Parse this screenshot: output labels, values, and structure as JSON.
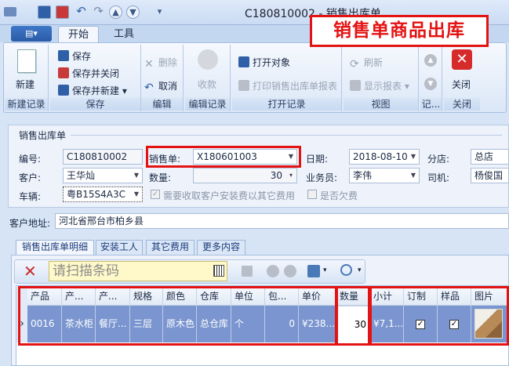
{
  "window": {
    "title": "C180810002 - 销售出库单"
  },
  "quick_access": {
    "separator": "|"
  },
  "callout": "销售单商品出库",
  "file_menu_glyph": "▤▾",
  "tabs": {
    "home": "开始",
    "tools": "工具"
  },
  "ribbon": {
    "new": "新建",
    "save": "保存",
    "save_close": "保存并关闭",
    "save_new": "保存并新建",
    "delete": "删除",
    "undo": "取消",
    "receive": "收款",
    "open_object": "打开对象",
    "print": "打印销售出库单报表",
    "refresh": "刷新",
    "show_report": "显示报表",
    "close": "关闭",
    "groups": {
      "new_record": "新建记录",
      "save": "保存",
      "edit": "编辑",
      "edit_record": "编辑记录",
      "open_record": "打开记录",
      "view": "视图",
      "record": "记...",
      "close": "关闭"
    }
  },
  "form": {
    "title": "销售出库单",
    "labels": {
      "code": "编号:",
      "sales_order": "销售单:",
      "date": "日期:",
      "branch": "分店:",
      "customer": "客户:",
      "quantity": "数量:",
      "salesman": "业务员:",
      "driver": "司机:",
      "vehicle": "车辆:",
      "need_fee": "需要收取客户安装费以其它费用",
      "owed": "是否欠费",
      "address": "客户地址:"
    },
    "values": {
      "code": "C180810002",
      "sales_order": "X180601003",
      "date": "2018-08-10",
      "branch": "总店",
      "customer": "王华灿",
      "quantity": "30",
      "salesman": "李伟",
      "driver": "杨俊国",
      "vehicle": "粤B15S4A3C",
      "address": "河北省邢台市柏乡县"
    },
    "checks": {
      "need_fee": "✓",
      "owed": ""
    }
  },
  "detail_tabs": [
    "销售出库单明细",
    "安装工人",
    "其它费用",
    "更多内容"
  ],
  "scan": {
    "placeholder": "请扫描条码"
  },
  "grid": {
    "headers": [
      "产品",
      "产...",
      "产...",
      "规格",
      "颜色",
      "仓库",
      "单位",
      "包...",
      "单价",
      "数量",
      "小计",
      "订制",
      "样品",
      "图片"
    ],
    "row": {
      "product": "0016",
      "name": "茶水柜",
      "room": "餐厅...",
      "spec": "三层",
      "color": "原木色",
      "warehouse": "总仓库",
      "unit": "个",
      "pack": "0",
      "price": "¥238...",
      "qty": "30",
      "subtotal": "¥7,1...",
      "custom": "✓",
      "sample": "✓"
    },
    "row_indicator": "›"
  },
  "colors": {
    "accent": "#e41313",
    "selection": "#7a95cf",
    "ribbon": "#dbe7f7"
  },
  "icons": [
    "app-icon",
    "save-icon",
    "undo-icon",
    "redo-icon",
    "new-doc-icon",
    "delete-icon",
    "coins-icon",
    "open-icon",
    "print-icon",
    "refresh-icon",
    "close-x-icon",
    "barcode-icon",
    "search-icon"
  ]
}
